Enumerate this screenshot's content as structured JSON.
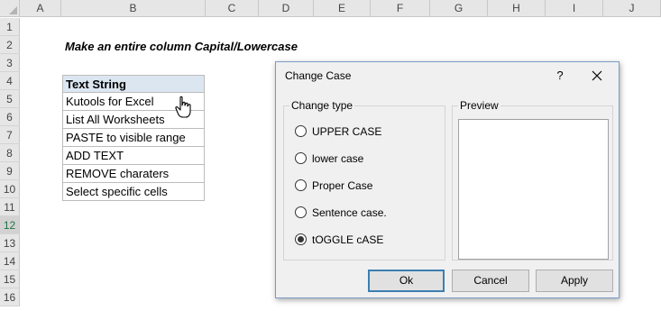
{
  "sheet": {
    "columns": [
      "A",
      "B",
      "C",
      "D",
      "E",
      "F",
      "G",
      "H",
      "I",
      "J"
    ],
    "rows": [
      "1",
      "2",
      "3",
      "4",
      "5",
      "6",
      "7",
      "8",
      "9",
      "10",
      "11",
      "12",
      "13",
      "14",
      "15",
      "16"
    ],
    "selected_row": "12",
    "heading": "Make an entire column Capital/Lowercase",
    "table_header": "Text String",
    "table_rows": [
      "Kutools for Excel",
      "List All Worksheets",
      "PASTE to visible range",
      "ADD TEXT",
      "REMOVE charaters",
      "Select specific cells"
    ]
  },
  "dialog": {
    "title": "Change Case",
    "help_label": "?",
    "change_type_label": "Change type",
    "options": [
      {
        "label": "UPPER CASE",
        "checked": false
      },
      {
        "label": "lower case",
        "checked": false
      },
      {
        "label": "Proper Case",
        "checked": false
      },
      {
        "label": "Sentence case.",
        "checked": false
      },
      {
        "label": "tOGGLE cASE",
        "checked": true
      }
    ],
    "preview_label": "Preview",
    "ok_label": "Ok",
    "cancel_label": "Cancel",
    "apply_label": "Apply"
  },
  "colors": {
    "header_bg": "#e6e6e6",
    "table_header_bg": "#dce6f1",
    "dialog_bg": "#f0f0f0",
    "dialog_border": "#7a9cc6",
    "default_button_border": "#3c7fb1",
    "selected_row_text": "#217346"
  }
}
